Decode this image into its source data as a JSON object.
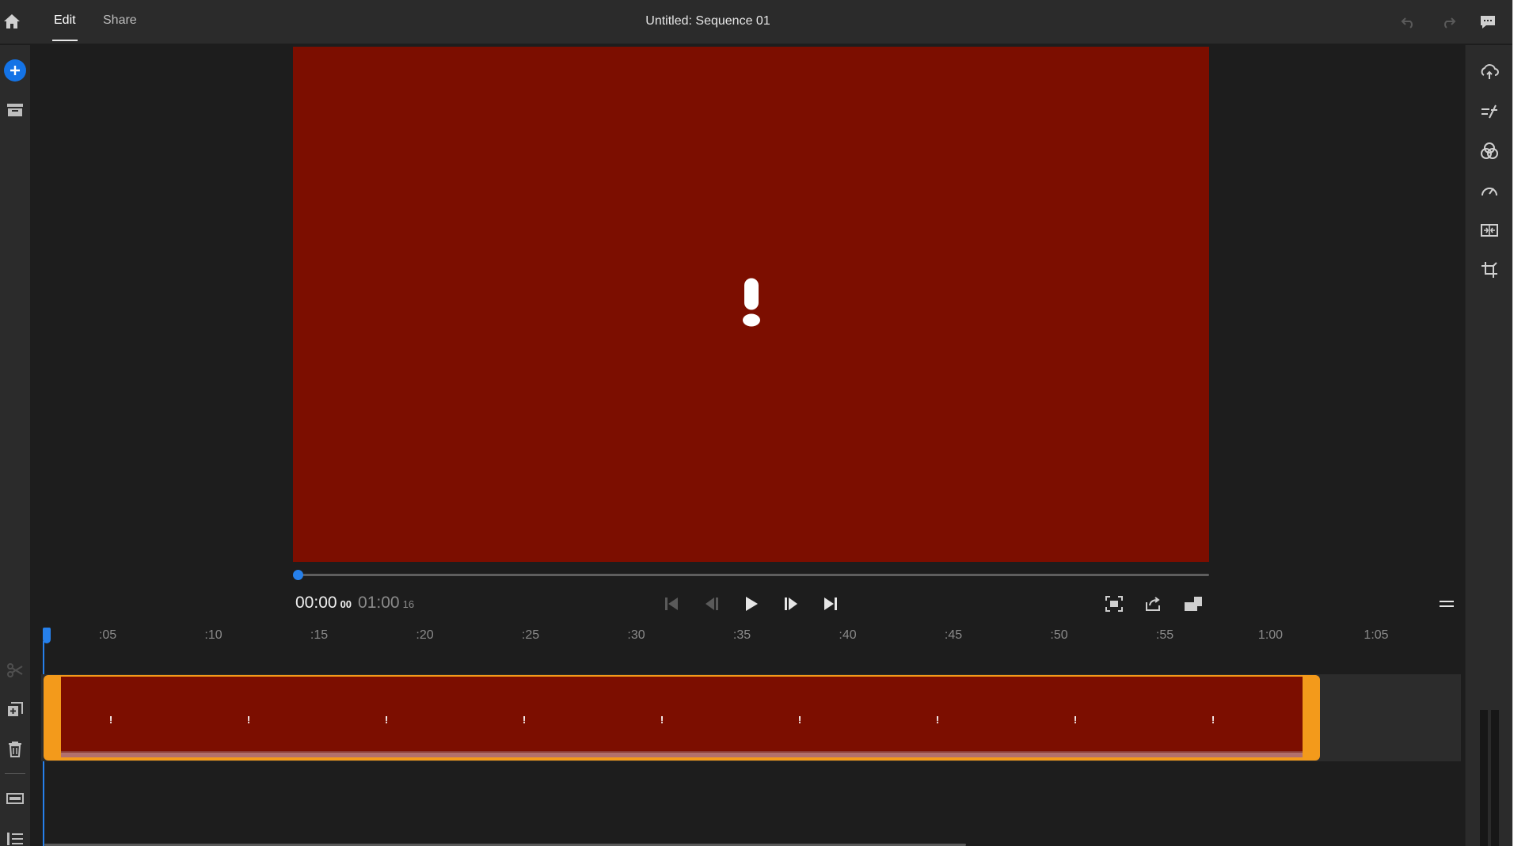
{
  "header": {
    "tabs": [
      {
        "label": "Edit",
        "active": true
      },
      {
        "label": "Share",
        "active": false
      }
    ],
    "title": "Untitled: Sequence 01",
    "icons": [
      "home-icon",
      "undo-icon",
      "redo-icon",
      "comment-icon"
    ]
  },
  "left_toolbar": {
    "items": [
      "add-media-icon",
      "media-bin-icon",
      "split-scissors-icon",
      "duplicate-icon",
      "delete-icon",
      "add-track-icon",
      "list-view-icon"
    ]
  },
  "right_toolbar": {
    "items": [
      "auto-reframe-icon",
      "adjust-effects-icon",
      "color-icon",
      "speed-icon",
      "transitions-icon",
      "crop-icon"
    ]
  },
  "viewer": {
    "background_color": "#7c0e00",
    "status_icon": "warning-exclamation-icon",
    "playback_progress": 0
  },
  "transport": {
    "current_time": "00:00",
    "current_frames": "00",
    "duration": "01:00",
    "duration_frames": "16",
    "controls": [
      "go-to-start-icon",
      "step-back-icon",
      "play-icon",
      "step-forward-icon",
      "go-to-end-icon"
    ],
    "view_controls": [
      "fit-to-screen-icon",
      "export-frame-icon",
      "aspect-ratio-icon",
      "panel-menu-icon"
    ]
  },
  "timeline": {
    "ruler_ticks": [
      ":05",
      ":10",
      ":15",
      ":20",
      ":25",
      ":30",
      ":35",
      ":40",
      ":45",
      ":50",
      ":55",
      "1:00",
      "1:05"
    ],
    "clip": {
      "border_color": "#f39a1b",
      "fill_color": "#7c0e00",
      "warning_marker_count": 9,
      "warning_marker": "!"
    }
  },
  "colors": {
    "accent": "#2680eb",
    "add_button": "#1473e6",
    "clip_border": "#f39a1b",
    "media_offline": "#7c0e00"
  }
}
